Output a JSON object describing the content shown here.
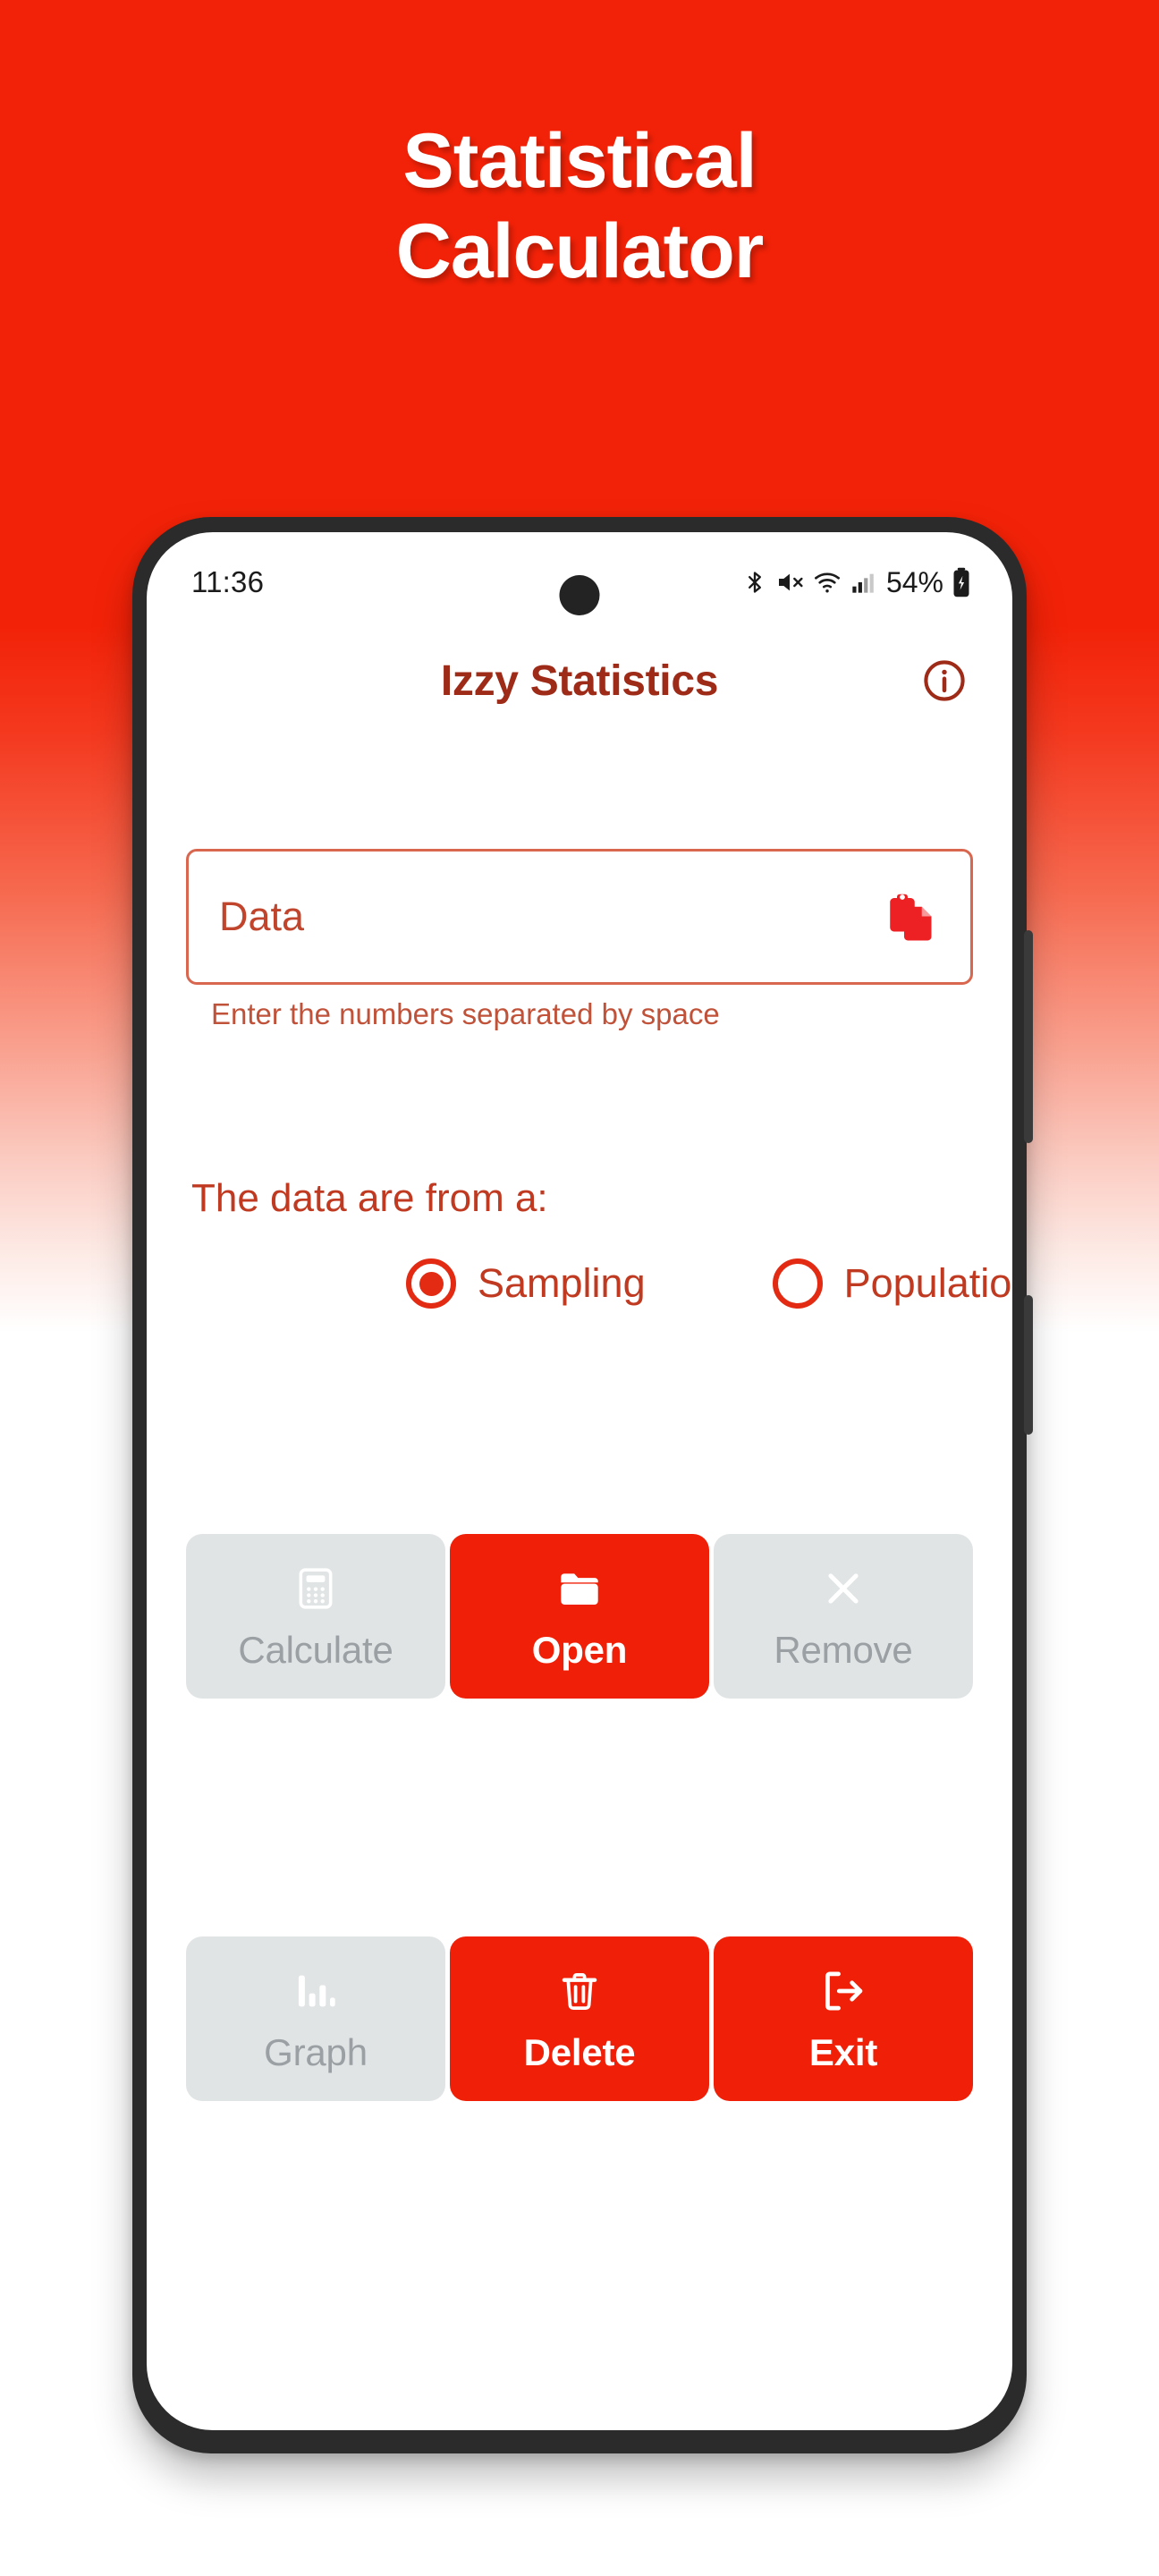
{
  "promo": {
    "line1": "Statistical",
    "line2": "Calculator",
    "background_color": "#F22208",
    "text_color": "#FFFFFF"
  },
  "phone": {
    "statusbar": {
      "clock": "11:36",
      "battery_percent": "54%",
      "icons": [
        "bluetooth-icon",
        "mute-icon",
        "wifi-icon",
        "cellular-signal-icon",
        "battery-icon"
      ]
    },
    "side_buttons": [
      "volume-rocker",
      "power-button"
    ]
  },
  "app": {
    "title": "Izzy Statistics",
    "title_color": "#9E2A18",
    "accent_color": "#F02008",
    "info_button": "info-icon",
    "data_input": {
      "placeholder": "Data",
      "value": "",
      "hint": "Enter the numbers separated by space",
      "paste_icon": "paste-icon"
    },
    "source": {
      "label": "The data are from a:",
      "options": [
        {
          "label": "Sampling",
          "selected": true
        },
        {
          "label": "Population",
          "selected": false
        }
      ]
    },
    "buttons": {
      "row1": [
        {
          "label": "Calculate",
          "icon": "calculator-icon",
          "state": "disabled"
        },
        {
          "label": "Open",
          "icon": "folder-icon",
          "state": "enabled"
        },
        {
          "label": "Remove",
          "icon": "close-icon",
          "state": "disabled"
        }
      ],
      "row2": [
        {
          "label": "Graph",
          "icon": "bar-chart-icon",
          "state": "disabled"
        },
        {
          "label": "Delete",
          "icon": "trash-icon",
          "state": "enabled"
        },
        {
          "label": "Exit",
          "icon": "logout-icon",
          "state": "enabled"
        }
      ]
    }
  }
}
